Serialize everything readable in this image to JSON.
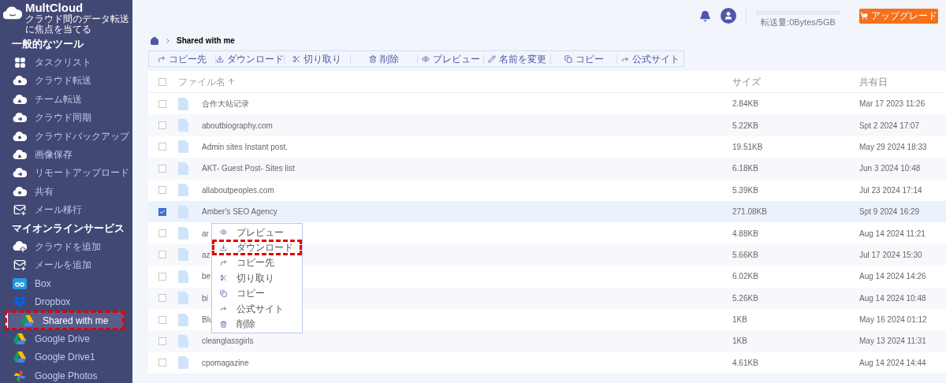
{
  "brand": {
    "name": "MultCloud",
    "tagline": "クラウド間のデータ転送に焦点を当てる"
  },
  "sidebar": {
    "sections": [
      {
        "title": "一般的なツール",
        "items": [
          {
            "label": "タスクリスト",
            "selected": false,
            "highlighted": false
          },
          {
            "label": "クラウド転送",
            "selected": false,
            "highlighted": false
          },
          {
            "label": "チーム転送",
            "selected": false,
            "highlighted": false
          },
          {
            "label": "クラウド同期",
            "selected": false,
            "highlighted": false
          },
          {
            "label": "クラウドバックアップ",
            "selected": false,
            "highlighted": false
          },
          {
            "label": "画像保存",
            "selected": false,
            "highlighted": false
          },
          {
            "label": "リモートアップロード",
            "selected": false,
            "highlighted": false
          },
          {
            "label": "共有",
            "selected": false,
            "highlighted": false
          },
          {
            "label": "メール移行",
            "selected": false,
            "highlighted": false
          }
        ]
      },
      {
        "title": "マイオンラインサービス",
        "items": [
          {
            "label": "クラウドを追加",
            "selected": false,
            "highlighted": false
          },
          {
            "label": "メールを追加",
            "selected": false,
            "highlighted": false
          },
          {
            "label": "Box",
            "selected": false,
            "highlighted": false
          },
          {
            "label": "Dropbox",
            "selected": false,
            "highlighted": false
          },
          {
            "label": "Shared with me",
            "selected": true,
            "highlighted": true
          },
          {
            "label": "Google Drive",
            "selected": false,
            "highlighted": false
          },
          {
            "label": "Google Drive1",
            "selected": false,
            "highlighted": false
          },
          {
            "label": "Google Photos",
            "selected": false,
            "highlighted": false
          }
        ]
      }
    ]
  },
  "header": {
    "usage": {
      "text": "転送量:0Bytes/5GB"
    },
    "upgrade_button": "アップグレード"
  },
  "breadcrumb": {
    "current": "Shared with me"
  },
  "toolbar": [
    "コピー先",
    "ダウンロード",
    "切り取り",
    "削除",
    "プレビュー",
    "名前を変更",
    "コピー",
    "公式サイト"
  ],
  "table": {
    "columns": [
      "ファイル名",
      "サイズ",
      "共有日"
    ],
    "all_checked": false,
    "rows": [
      {
        "name": "合作大站记录",
        "size": "2.84KB",
        "date": "Mar 17 2023 11:26",
        "checked": false
      },
      {
        "name": "aboutbiography.com",
        "size": "5.22KB",
        "date": "Spt 2 2024 17:07",
        "checked": false
      },
      {
        "name": "Admin sites Instant post.",
        "size": "19.51KB",
        "date": "May 29 2024 18:33",
        "checked": false
      },
      {
        "name": "AKT- Guest Post- Sites list",
        "size": "6.18KB",
        "date": "Jun 3 2024 10:48",
        "checked": false
      },
      {
        "name": "allaboutpeoples.com",
        "size": "5.39KB",
        "date": "Jul 23 2024 17:14",
        "checked": false
      },
      {
        "name": "Amber's SEO Agency",
        "size": "271.08KB",
        "date": "Spt 9 2024 16:29",
        "checked": true
      },
      {
        "name": "ar",
        "size": "4.88KB",
        "date": "Aug 14 2024 11:21",
        "checked": false
      },
      {
        "name": "az",
        "size": "5.66KB",
        "date": "Jul 17 2024 15:30",
        "checked": false
      },
      {
        "name": "be",
        "size": "6.02KB",
        "date": "Aug 14 2024 14:26",
        "checked": false
      },
      {
        "name": "bi",
        "size": "5.26KB",
        "date": "Aug 14 2024 10:48",
        "checked": false
      },
      {
        "name": "Blu",
        "size": "1KB",
        "date": "May 16 2024 01:12",
        "checked": false
      },
      {
        "name": "cleanglassgirls",
        "size": "1KB",
        "date": "May 13 2024 11:31",
        "checked": false
      },
      {
        "name": "cpomagazine",
        "size": "4.61KB",
        "date": "Aug 14 2024 14:44",
        "checked": false
      }
    ]
  },
  "context_menu": [
    {
      "label": "プレビュー",
      "highlighted": false
    },
    {
      "label": "ダウンロード",
      "highlighted": true
    },
    {
      "label": "コピー先",
      "highlighted": false
    },
    {
      "label": "切り取り",
      "highlighted": false
    },
    {
      "label": "コピー",
      "highlighted": false
    },
    {
      "label": "公式サイト",
      "highlighted": false
    },
    {
      "label": "削除",
      "highlighted": false
    }
  ]
}
